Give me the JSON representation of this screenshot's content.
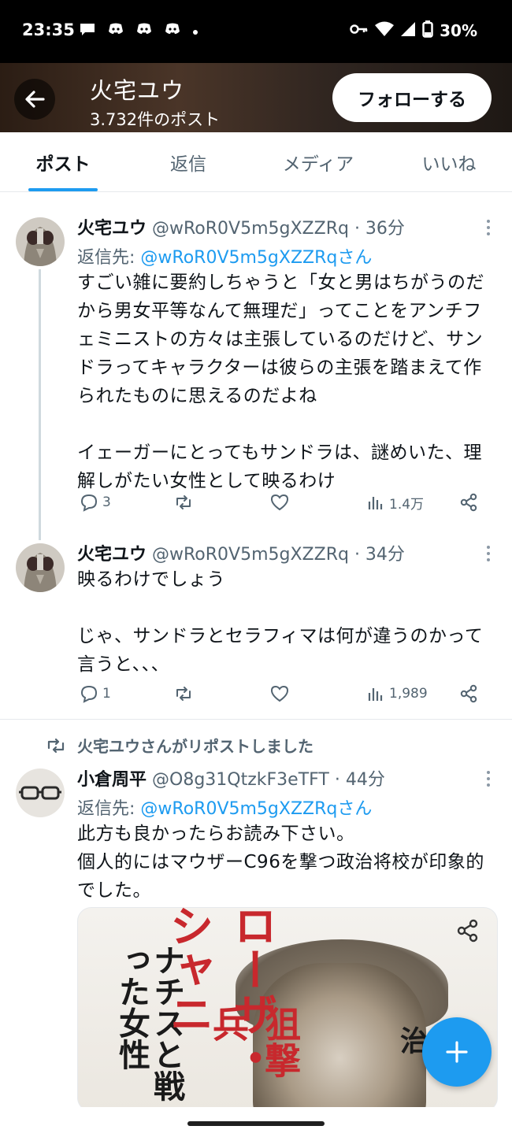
{
  "status_bar": {
    "time": "23:35",
    "battery": "30%",
    "left_icons": [
      "chat-bubble-icon",
      "discord-icon",
      "discord-icon",
      "discord-icon",
      "dot-icon"
    ],
    "right_icons": [
      "vpn-key-icon",
      "wifi-icon",
      "signal-icon",
      "battery-icon"
    ]
  },
  "header": {
    "title": "火宅ユウ",
    "subtitle": "3.732件のポスト",
    "follow_label": "フォローする"
  },
  "tabs": [
    {
      "label": "ポスト",
      "active": true
    },
    {
      "label": "返信",
      "active": false
    },
    {
      "label": "メディア",
      "active": false
    },
    {
      "label": "いいね",
      "active": false
    }
  ],
  "posts": [
    {
      "name": "火宅ユウ",
      "meta": "@wRoR0V5m5gXZZRq · 36分",
      "reply_prefix": "返信先: ",
      "reply_mention": "@wRoR0V5m5gXZZRqさん",
      "text": "すごい雑に要約しちゃうと「女と男はちがうのだから男女平等なんて無理だ」ってことをアンチフェミニストの方々は主張しているのだけど、サンドラってキャラクターは彼らの主張を踏まえて作られたものに思えるのだよね\n\nイェーガーにとってもサンドラは、謎めいた、理解しがたい女性として映るわけ",
      "replies": "3",
      "views": "1.4万"
    },
    {
      "name": "火宅ユウ",
      "meta": "@wRoR0V5m5gXZZRq · 34分",
      "text": "映るわけでしょう\n\nじゃ、サンドラとセラフィマは何が違うのかって言うと、、、",
      "replies": "1",
      "views": "1,989"
    },
    {
      "repost_note": "火宅ユウさんがリポストしました",
      "name": "小倉周平",
      "meta": "@O8g31QtzkF3eTFT · 44分",
      "reply_prefix": "返信先: ",
      "reply_mention": "@wRoR0V5m5gXZZRqさん",
      "text": "此方も良かったらお読み下さい。\n個人的にはマウザーC96を撃つ政治将校が印象的でした。",
      "media": {
        "subtitle": "ナチスと戦った女性",
        "title": "ローザ・シャニ",
        "badge": "狙撃兵",
        "author": "秋 治"
      }
    }
  ],
  "colors": {
    "accent": "#1d9bf0",
    "text_primary": "#0f1419",
    "text_secondary": "#536471"
  }
}
